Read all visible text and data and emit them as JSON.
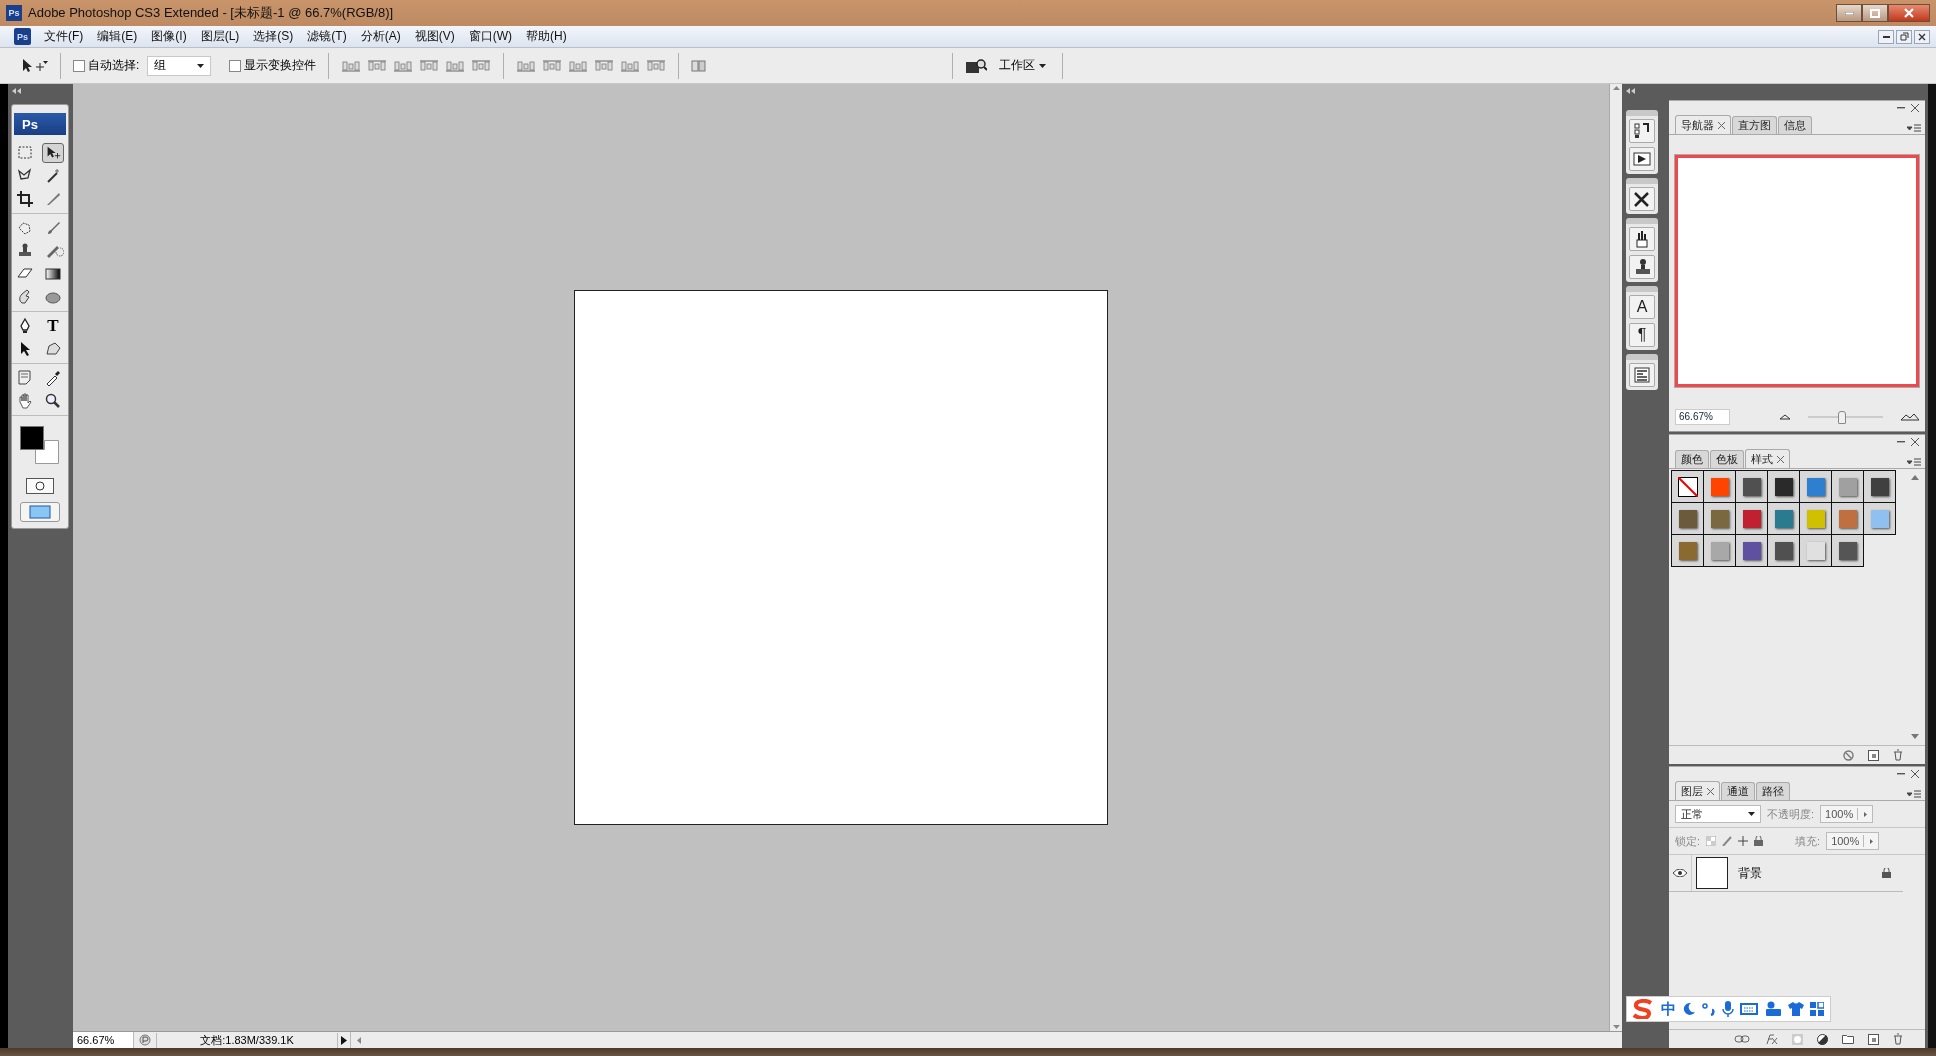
{
  "window": {
    "icon_label": "Ps",
    "title": "Adobe Photoshop CS3 Extended - [未标题-1 @ 66.7%(RGB/8)]"
  },
  "menu": {
    "icon_label": "Ps",
    "items": [
      "文件(F)",
      "编辑(E)",
      "图像(I)",
      "图层(L)",
      "选择(S)",
      "滤镜(T)",
      "分析(A)",
      "视图(V)",
      "窗口(W)",
      "帮助(H)"
    ]
  },
  "options": {
    "auto_select": {
      "label": "自动选择:",
      "checked": false
    },
    "auto_select_target": "组",
    "show_transform": {
      "label": "显示变换控件",
      "checked": false
    },
    "workspace": "工作区"
  },
  "toolbox": {
    "logo": "Ps",
    "tools": [
      {
        "kind": "marquee",
        "selected": false
      },
      {
        "kind": "move",
        "selected": true
      },
      {
        "kind": "lasso",
        "selected": false
      },
      {
        "kind": "wand",
        "selected": false
      },
      {
        "kind": "crop",
        "selected": false
      },
      {
        "kind": "slice",
        "selected": false
      },
      {
        "kind": "healing",
        "selected": false
      },
      {
        "kind": "brush",
        "selected": false
      },
      {
        "kind": "stamp",
        "selected": false
      },
      {
        "kind": "history",
        "selected": false
      },
      {
        "kind": "eraser",
        "selected": false
      },
      {
        "kind": "gradient",
        "selected": false
      },
      {
        "kind": "smudge",
        "selected": false
      },
      {
        "kind": "dodge",
        "selected": false
      },
      {
        "kind": "pen",
        "selected": false
      },
      {
        "kind": "type",
        "selected": false,
        "glyph": "T"
      },
      {
        "kind": "arrow",
        "selected": false
      },
      {
        "kind": "shape",
        "selected": false
      },
      {
        "kind": "notes",
        "selected": false
      },
      {
        "kind": "eyedropper",
        "selected": false
      },
      {
        "kind": "hand",
        "selected": false
      },
      {
        "kind": "zoom",
        "selected": false
      }
    ]
  },
  "dock": [
    {
      "kind": "history"
    },
    {
      "kind": "actions"
    },
    {
      "kind": "tools"
    },
    {
      "kind": "brushes"
    },
    {
      "kind": "clone"
    },
    {
      "kind": "character",
      "glyph": "A"
    },
    {
      "kind": "paragraph",
      "glyph": "¶"
    },
    {
      "kind": "comps"
    }
  ],
  "navigator": {
    "tabs": [
      {
        "label": "导航器",
        "selected": true
      },
      {
        "label": "直方图",
        "selected": false
      },
      {
        "label": "信息",
        "selected": false
      }
    ],
    "zoom": "66.67%",
    "level": 0.45
  },
  "styles": {
    "tabs": [
      {
        "label": "颜色",
        "selected": false
      },
      {
        "label": "色板",
        "selected": false
      },
      {
        "label": "样式",
        "selected": true
      }
    ],
    "swatches": [
      {
        "kind": "none",
        "color": "#ffffff"
      },
      {
        "kind": "style",
        "color": "#ff4400"
      },
      {
        "kind": "style",
        "color": "#505050"
      },
      {
        "kind": "style",
        "color": "#2a2a2a"
      },
      {
        "kind": "style",
        "color": "#2f7fd0"
      },
      {
        "kind": "style",
        "color": "#a0a0a0"
      },
      {
        "kind": "style",
        "color": "#404040"
      },
      {
        "kind": "style",
        "color": "#6b5a3c"
      },
      {
        "kind": "style",
        "color": "#7a6840"
      },
      {
        "kind": "style",
        "color": "#c02030"
      },
      {
        "kind": "style",
        "color": "#2a7a90"
      },
      {
        "kind": "style",
        "color": "#d0c000"
      },
      {
        "kind": "style",
        "color": "#c07040"
      },
      {
        "kind": "style",
        "color": "#90c0f0"
      },
      {
        "kind": "style",
        "color": "#8a6a30"
      },
      {
        "kind": "style",
        "color": "#a8a8a8"
      },
      {
        "kind": "style",
        "color": "#6050a0"
      },
      {
        "kind": "style",
        "color": "#505050"
      },
      {
        "kind": "style",
        "color": "#e0e0e0"
      },
      {
        "kind": "style",
        "color": "#555555"
      }
    ]
  },
  "layers": {
    "tabs": [
      {
        "label": "图层",
        "selected": true
      },
      {
        "label": "通道",
        "selected": false
      },
      {
        "label": "路径",
        "selected": false
      }
    ],
    "blend_mode": "正常",
    "opacity_label": "不透明度:",
    "opacity": "100%",
    "lock_label": "锁定:",
    "fill_label": "填充:",
    "fill": "100%",
    "items": [
      {
        "name": "背景",
        "visible": true,
        "locked": true
      }
    ]
  },
  "ime_bar": {
    "mode": "中"
  },
  "status": {
    "zoom": "66.67%",
    "doc": "文档:1.83M/339.1K"
  }
}
